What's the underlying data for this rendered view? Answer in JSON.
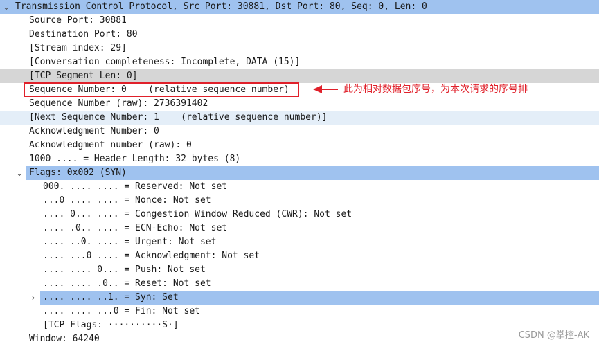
{
  "tcp_header": "Transmission Control Protocol, Src Port: 30881, Dst Port: 80, Seq: 0, Len: 0",
  "fields": [
    "Source Port: 30881",
    "Destination Port: 80",
    "[Stream index: 29]",
    "[Conversation completeness: Incomplete, DATA (15)]",
    "[TCP Segment Len: 0]",
    "Sequence Number: 0    (relative sequence number)",
    "Sequence Number (raw): 2736391402",
    "[Next Sequence Number: 1    (relative sequence number)]",
    "Acknowledgment Number: 0",
    "Acknowledgment number (raw): 0",
    "1000 .... = Header Length: 32 bytes (8)"
  ],
  "flags_header": "Flags: 0x002 (SYN)",
  "flags": [
    "000. .... .... = Reserved: Not set",
    "...0 .... .... = Nonce: Not set",
    ".... 0... .... = Congestion Window Reduced (CWR): Not set",
    ".... .0.. .... = ECN-Echo: Not set",
    ".... ..0. .... = Urgent: Not set",
    ".... ...0 .... = Acknowledgment: Not set",
    ".... .... 0... = Push: Not set",
    ".... .... .0.. = Reset: Not set",
    ".... .... ..1. = Syn: Set",
    ".... .... ...0 = Fin: Not set",
    "[TCP Flags: ··········S·]"
  ],
  "window": "Window: 64240",
  "annotation": "此为相对数据包序号，为本次请求的序号排",
  "watermark": "CSDN @掌控-AK",
  "colors": {
    "selection": "#9fc2ef",
    "annotation_red": "#e0202a"
  },
  "icons": {
    "expanded": "chevron-down-icon",
    "collapsed": "chevron-right-icon"
  }
}
